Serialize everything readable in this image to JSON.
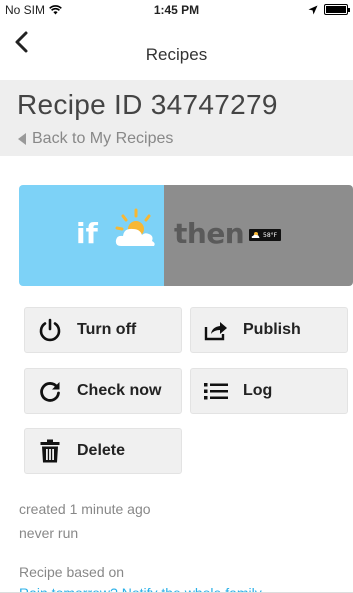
{
  "status_bar": {
    "carrier": "No SIM",
    "time": "1:45 PM",
    "battery_level": 1.0
  },
  "nav": {
    "title": "Recipes",
    "back_icon": "chevron-left-icon"
  },
  "header": {
    "recipe_id": "Recipe ID 34747279",
    "back_link": "Back to My Recipes"
  },
  "recipe_card": {
    "if_label": "if",
    "then_label": "then",
    "trigger_icon": "sun-cloud-icon",
    "action_chip_text": "58°F",
    "colors": {
      "if_bg": "#7dd2f7",
      "then_bg": "#8d8d8d"
    }
  },
  "actions": {
    "turn_off": "Turn off",
    "publish": "Publish",
    "check_now": "Check now",
    "log": "Log",
    "delete": "Delete"
  },
  "meta": {
    "created": "created 1 minute ago",
    "last_run": "never run",
    "based_on_label": "Recipe based on",
    "based_on_link": "Rain tomorrow? Notify the whole family"
  },
  "colors": {
    "link": "#2ab0e8",
    "header_bg": "#eeeeee",
    "button_bg": "#f0f0f0"
  }
}
